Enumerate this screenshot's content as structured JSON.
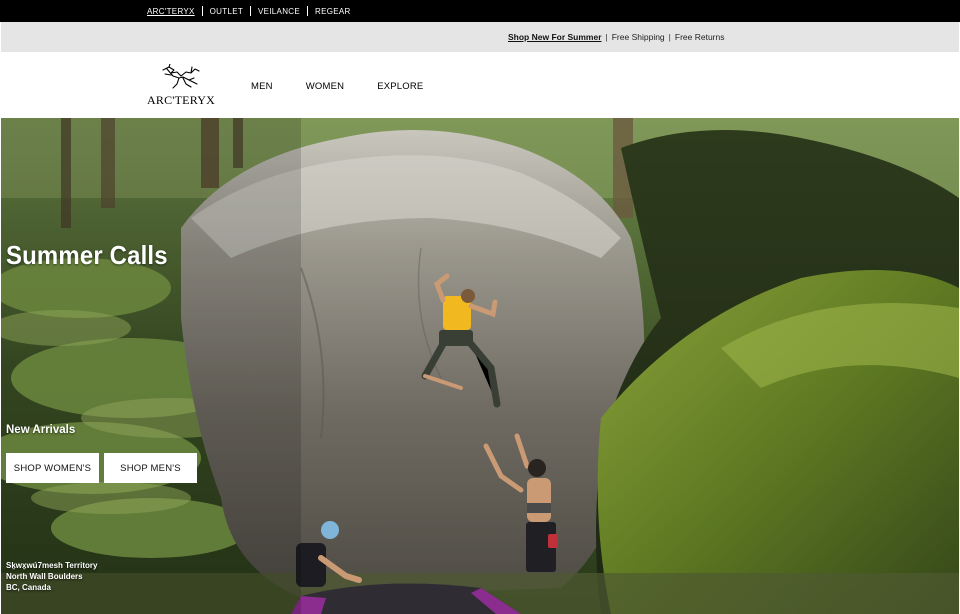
{
  "brandbar": {
    "links": [
      "ARC'TERYX",
      "OUTLET",
      "VEILANCE",
      "REGEAR"
    ]
  },
  "promo": {
    "link": "Shop New For Summer",
    "sep": "|",
    "shipping": "Free Shipping",
    "returns": "Free Returns"
  },
  "header": {
    "logo_text": "ARC'TERYX",
    "nav": [
      "MEN",
      "WOMEN",
      "EXPLORE"
    ]
  },
  "hero": {
    "title": "Summer Calls",
    "subtitle": "New Arrivals",
    "buttons": [
      "SHOP WOMEN'S",
      "SHOP MEN'S"
    ],
    "caption": [
      "Sḵwx̱wú7mesh Territory",
      "North Wall Boulders",
      "BC, Canada"
    ]
  },
  "colors": {
    "topbar": "#000000",
    "promobar": "#e5e5e5",
    "moss": "#5f7a2a",
    "rock": "#8e8c84",
    "climber_shirt": "#f2b820"
  }
}
